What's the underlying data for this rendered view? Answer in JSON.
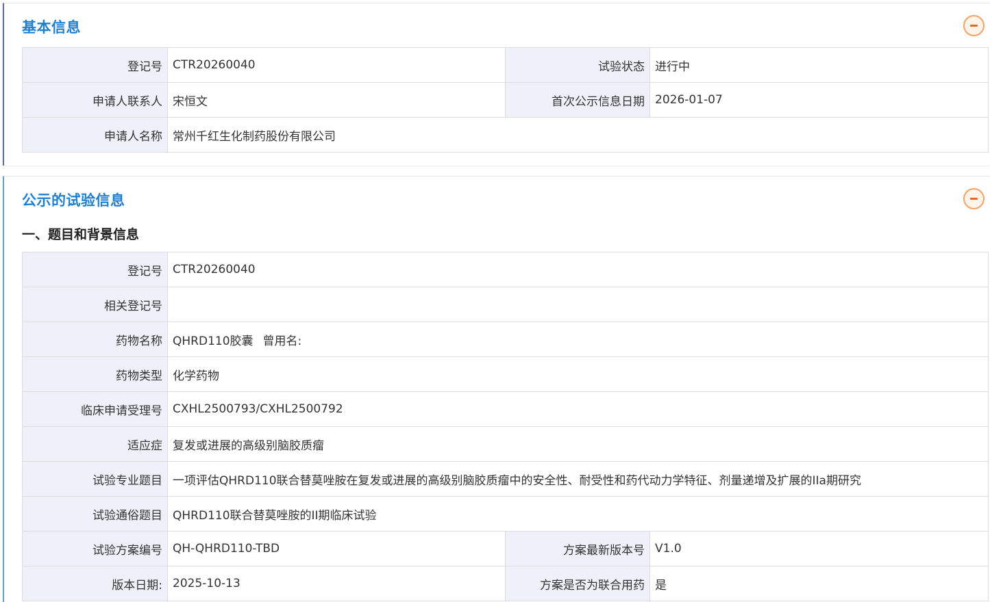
{
  "basic": {
    "title": "基本信息",
    "rows": {
      "reg_no_label": "登记号",
      "reg_no": "CTR20260040",
      "status_label": "试验状态",
      "status": "进行中",
      "contact_label": "申请人联系人",
      "contact": "宋恒文",
      "first_pub_label": "首次公示信息日期",
      "first_pub": "2026-01-07",
      "applicant_label": "申请人名称",
      "applicant": "常州千红生化制药股份有限公司"
    }
  },
  "public": {
    "title": "公示的试验信息",
    "section_title": "一、题目和背景信息",
    "rows": {
      "reg_no_label": "登记号",
      "reg_no": "CTR20260040",
      "related_label": "相关登记号",
      "related": "",
      "drug_name_label": "药物名称",
      "drug_name": "QHRD110胶囊",
      "former_name_label": "曾用名:",
      "drug_type_label": "药物类型",
      "drug_type": "化学药物",
      "accept_no_label": "临床申请受理号",
      "accept_no": "CXHL2500793/CXHL2500792",
      "indication_label": "适应症",
      "indication": "复发或进展的高级别脑胶质瘤",
      "pro_title_label": "试验专业题目",
      "pro_title": "一项评估QHRD110联合替莫唑胺在复发或进展的高级别脑胶质瘤中的安全性、耐受性和药代动力学特征、剂量递增及扩展的IIa期研究",
      "pop_title_label": "试验通俗题目",
      "pop_title": "QHRD110联合替莫唑胺的II期临床试验",
      "protocol_no_label": "试验方案编号",
      "protocol_no": "QH-QHRD110-TBD",
      "version_label": "方案最新版本号",
      "version": "V1.0",
      "version_date_label": "版本日期:",
      "version_date": "2025-10-13",
      "combo_label": "方案是否为联合用药",
      "combo": "是"
    }
  },
  "colors": {
    "title_blue": "#1e7fcf",
    "label_bg": "#eef1f9",
    "collapse_orange": "#e9661a"
  },
  "icons": {
    "collapse": "minus-circle-icon"
  }
}
